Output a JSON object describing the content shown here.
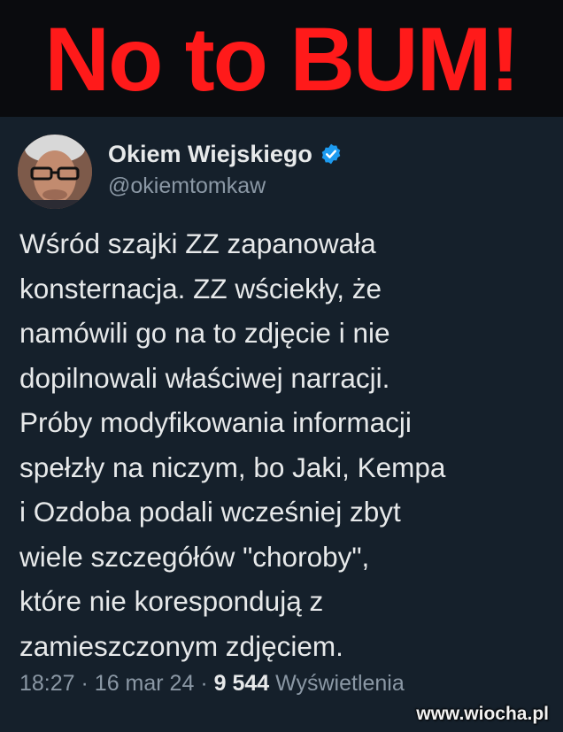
{
  "banner": {
    "text": "No to BUM!"
  },
  "tweet": {
    "author_name": "Okiem Wiejskiego",
    "author_handle": "@okiemtomkaw",
    "body_lines": [
      "Wśród szajki ZZ zapanowała",
      "konsternacja. ZZ wściekły, że",
      "namówili go na to zdjęcie i nie",
      "dopilnowali właściwej narracji.",
      "Próby modyfikowania informacji",
      "spełzły na niczym, bo Jaki, Kempa",
      "i Ozdoba podali wcześniej zbyt",
      "wiele szczegółów \"choroby\",",
      "które nie korespondują z",
      "zamieszczonym zdjęciem."
    ],
    "time": "18:27",
    "date": "16 mar 24",
    "views_count": "9 544",
    "views_label": "Wyświetlenia"
  },
  "watermark": "www.wiocha.pl",
  "colors": {
    "banner_text": "#ff1a1a",
    "tweet_background": "#15202b",
    "verified_badge": "#1d9bf0",
    "secondary_text": "#8b98a5"
  },
  "icons": {
    "verified": "verified-badge-icon"
  }
}
